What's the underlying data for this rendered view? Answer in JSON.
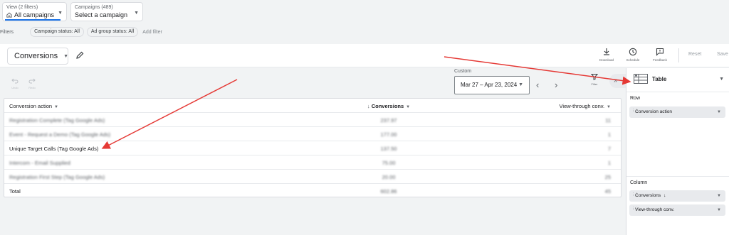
{
  "top": {
    "view_small": "View (2 filters)",
    "view_main": "All campaigns",
    "campaigns_small": "Campaigns (489)",
    "campaigns_main": "Select a campaign",
    "filters_label": "Filters",
    "chips": [
      "Campaign status: All",
      "Ad group status: All"
    ],
    "add_filter": "Add filter"
  },
  "header": {
    "report_name": "Conversions",
    "tools": [
      "Download",
      "Schedule",
      "Feedback"
    ],
    "reset": "Reset",
    "save": "Save"
  },
  "toolbar": {
    "undo": "Undo",
    "redo": "Redo",
    "date_label": "Custom",
    "date_range": "Mar 27 – Apr 23, 2024",
    "filter": "Filter"
  },
  "table": {
    "headers": [
      "Conversion action",
      "Conversions",
      "View-through conv."
    ],
    "rows": [
      [
        "Registration Complete (Tag Google Ads)",
        "237.97",
        "11"
      ],
      [
        "Event - Request a Demo (Tag Google Ads)",
        "177.00",
        "1"
      ],
      [
        "Unique Target Calls (Tag Google Ads)",
        "137.50",
        "7"
      ],
      [
        "Intercom - Email Supplied",
        "75.00",
        "1"
      ],
      [
        "Registration First Step (Tag Google Ads)",
        "20.00",
        "25"
      ]
    ],
    "blurred": [
      true,
      true,
      false,
      true,
      true
    ],
    "total": [
      "Total",
      "602.86",
      "45"
    ]
  },
  "panel": {
    "type": "Table",
    "row_label": "Row",
    "row_items": [
      "Conversion action"
    ],
    "column_label": "Column",
    "column_items": [
      "Conversions",
      "View-through conv."
    ]
  },
  "colors": {
    "accent": "#1a73e8",
    "annotation": "#e53935"
  }
}
